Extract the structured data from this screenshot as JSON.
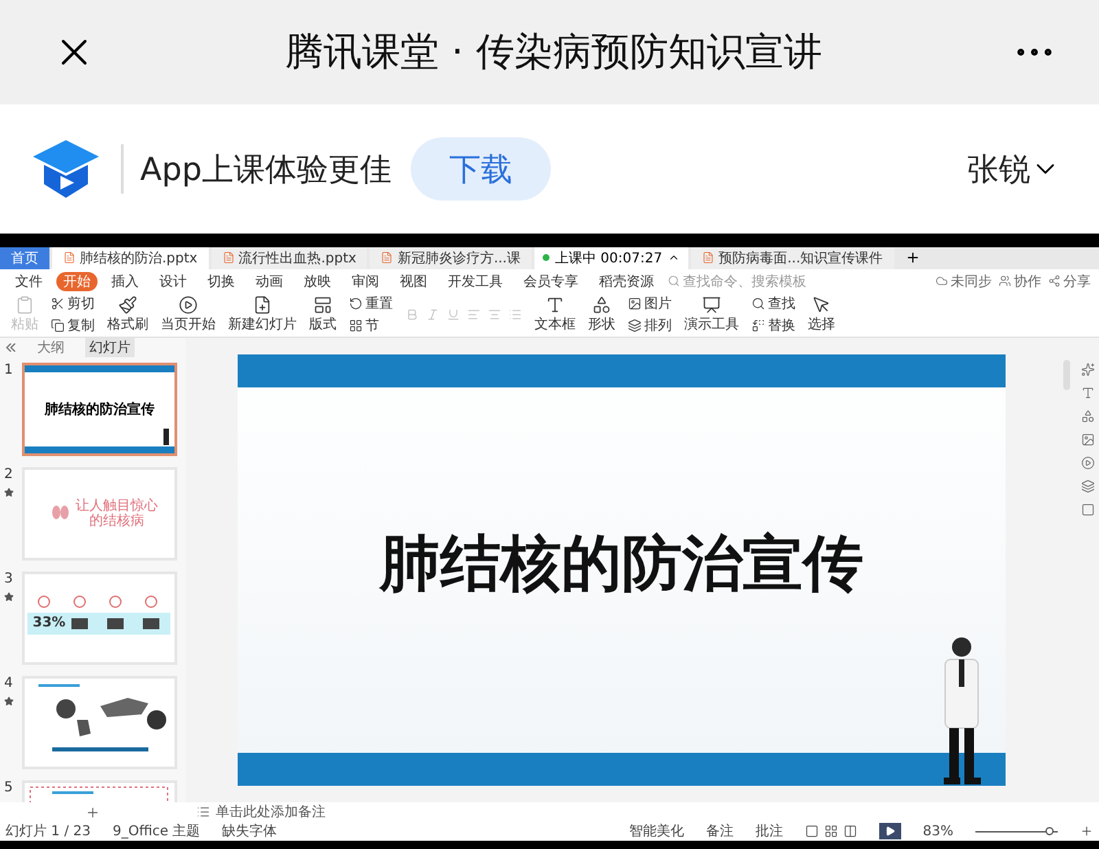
{
  "top_bar": {
    "title": "腾讯课堂 · 传染病预防知识宣讲"
  },
  "banner": {
    "slogan": "App上课体验更佳",
    "download_button": "下载",
    "user": "张锐"
  },
  "wps": {
    "tabs": [
      {
        "label": "首页",
        "kind": "home",
        "selected": false
      },
      {
        "label": "肺结核的防治.pptx",
        "kind": "doc",
        "selected": true
      },
      {
        "label": "流行性出血热.pptx",
        "kind": "doc",
        "selected": false
      },
      {
        "label": "新冠肺炎诊疗方...课",
        "kind": "doc",
        "selected": false
      },
      {
        "label": "上课中",
        "time": "00:07:27",
        "kind": "live",
        "selected": false
      },
      {
        "label": "预防病毒面...知识宣传课件",
        "kind": "doc",
        "selected": false
      }
    ],
    "menu": [
      {
        "label": "文件",
        "selected": false
      },
      {
        "label": "开始",
        "selected": true
      },
      {
        "label": "插入",
        "selected": false
      },
      {
        "label": "设计",
        "selected": false
      },
      {
        "label": "切换",
        "selected": false
      },
      {
        "label": "动画",
        "selected": false
      },
      {
        "label": "放映",
        "selected": false
      },
      {
        "label": "审阅",
        "selected": false
      },
      {
        "label": "视图",
        "selected": false
      },
      {
        "label": "开发工具",
        "selected": false
      },
      {
        "label": "会员专享",
        "selected": false
      },
      {
        "label": "稻壳资源",
        "selected": false
      }
    ],
    "search": {
      "placeholder": "查找命令、搜索模板"
    },
    "actions": [
      "未同步",
      "协作",
      "分享"
    ],
    "ribbon": [
      {
        "kind": "large",
        "label": "粘贴",
        "disabled": true
      },
      {
        "kind": "pair",
        "items": [
          "剪切",
          "复制"
        ]
      },
      {
        "kind": "large",
        "label": "格式刷",
        "disabled": false
      },
      {
        "kind": "large",
        "label": "当页开始",
        "disabled": false
      },
      {
        "kind": "large",
        "label": "新建幻灯片",
        "disabled": false
      },
      {
        "kind": "large",
        "label": "版式",
        "disabled": false
      },
      {
        "kind": "pair",
        "items": [
          "重置",
          "节"
        ]
      },
      {
        "kind": "fonts"
      },
      {
        "kind": "large",
        "label": "文本框",
        "disabled": false
      },
      {
        "kind": "large",
        "label": "形状",
        "disabled": false
      },
      {
        "kind": "pair",
        "items": [
          "图片",
          "排列"
        ]
      },
      {
        "kind": "large",
        "label": "演示工具",
        "disabled": false
      },
      {
        "kind": "pair",
        "items": [
          "查找",
          "替换"
        ]
      },
      {
        "kind": "large",
        "label": "选择",
        "disabled": false
      }
    ],
    "panel_tabs": [
      {
        "label": "大纲",
        "selected": false
      },
      {
        "label": "幻灯片",
        "selected": true
      }
    ],
    "thumbnails": [
      {
        "number": "1",
        "kind": "title",
        "selected": true,
        "title": "肺结核的防治宣传"
      },
      {
        "number": "2",
        "kind": "quote",
        "selected": false,
        "animated": true,
        "title": "让人触目惊心的结核病"
      },
      {
        "number": "3",
        "kind": "stats",
        "selected": false,
        "animated": true,
        "figure": "33%"
      },
      {
        "number": "4",
        "kind": "map",
        "selected": false,
        "animated": true
      },
      {
        "number": "5",
        "kind": "frame",
        "selected": false
      }
    ],
    "slide": {
      "title": "肺结核的防治宣传"
    },
    "notes": {
      "placeholder": "单击此处添加备注"
    },
    "status": {
      "slide": "幻灯片 1 / 23",
      "theme": "9_Office 主题",
      "fonts": "缺失字体",
      "beautify": "智能美化",
      "notes": "备注",
      "comments": "批注",
      "zoom": "83%",
      "zoom_slider": {
        "level": 0.9
      }
    }
  }
}
